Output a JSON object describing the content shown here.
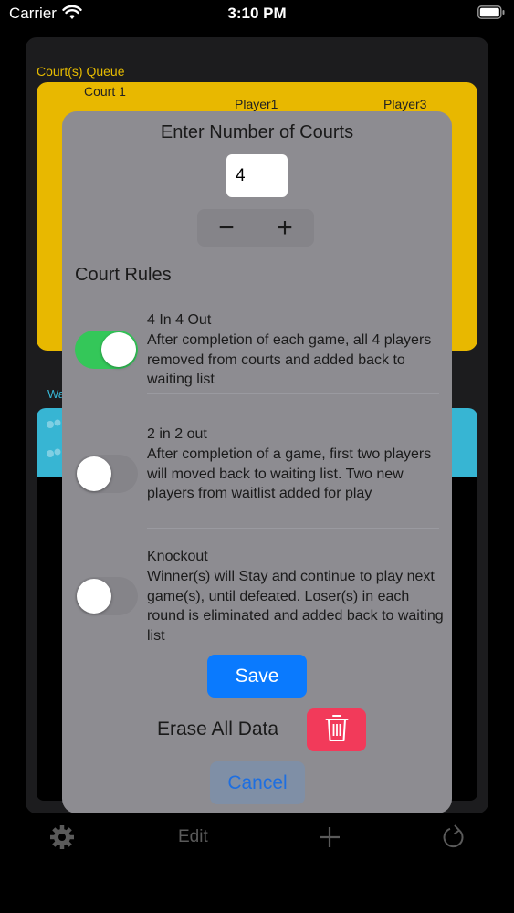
{
  "status_bar": {
    "carrier": "Carrier",
    "time": "3:10 PM"
  },
  "background": {
    "queue_title": "Court(s) Queue",
    "court_label": "Court 1",
    "player1": "Player1",
    "player3": "Player3",
    "waiting_label": "Wa"
  },
  "modal": {
    "title": "Enter Number of Courts",
    "courts_value": "4",
    "stepper": {
      "minus": "−",
      "plus": "+"
    },
    "rules_title": "Court Rules",
    "rules": [
      {
        "title": "4 In 4 Out",
        "description": "After completion of each game, all 4 players  removed from courts and  added back to waiting list",
        "enabled": true
      },
      {
        "title": "2 in 2 out",
        "description": "After completion of a game, first two players will moved back to waiting list. Two new players from waitlist added for play",
        "enabled": false
      },
      {
        "title": "Knockout",
        "description": "Winner(s) will Stay and continue to play next game(s), until defeated. Loser(s) in each round is eliminated and added back to waiting list",
        "enabled": false
      }
    ],
    "save_label": "Save",
    "erase_label": "Erase All Data",
    "cancel_label": "Cancel"
  },
  "tab_bar": {
    "edit_label": "Edit"
  },
  "colors": {
    "toggle_on": "#34c759",
    "toggle_off": "#858489",
    "save": "#0a7afe",
    "erase": "#f23a5a",
    "queue_accent": "#e8b800",
    "waiting_accent": "#37b5d3"
  },
  "icons": [
    "wifi-icon",
    "battery-icon",
    "minus-icon",
    "plus-icon",
    "trash-icon",
    "gear-icon",
    "add-icon",
    "refresh-icon",
    "players-icon"
  ]
}
